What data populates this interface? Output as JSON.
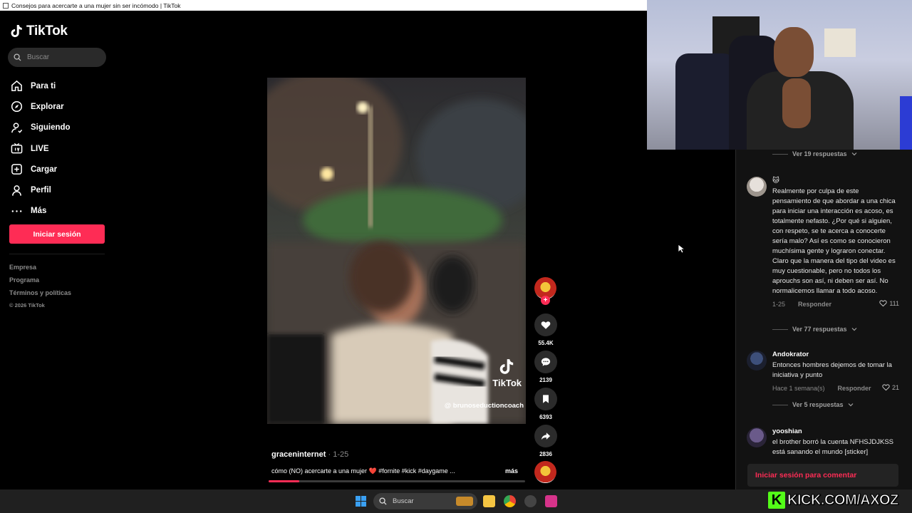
{
  "window": {
    "title": "Consejos para acercarte a una mujer sin ser incómodo | TikTok"
  },
  "sidebar": {
    "logo_text": "TikTok",
    "search_placeholder": "Buscar",
    "nav": [
      {
        "label": "Para ti",
        "icon": "home-icon"
      },
      {
        "label": "Explorar",
        "icon": "compass-icon"
      },
      {
        "label": "Siguiendo",
        "icon": "user-follow-icon"
      },
      {
        "label": "LIVE",
        "icon": "live-tv-icon"
      },
      {
        "label": "Cargar",
        "icon": "upload-plus-icon"
      },
      {
        "label": "Perfil",
        "icon": "profile-icon"
      },
      {
        "label": "Más",
        "icon": "more-dots-icon"
      }
    ],
    "login_label": "Iniciar sesión",
    "footer": [
      "Empresa",
      "Programa",
      "Términos y políticas"
    ],
    "copyright": "© 2026 TikTok"
  },
  "video": {
    "watermark": "TikTok",
    "watermark_handle": "@ brunoseductioncoach",
    "author": "graceninternet",
    "date": " · 1-25",
    "description": "cómo (NO) acercarte a una mujer ❤️ #fornite #kick #daygame ...",
    "more_label": "más",
    "progress": 0.12
  },
  "actions": {
    "follow_plus": "+",
    "likes": "55.4K",
    "comments": "2139",
    "saves": "6393",
    "shares": "2836"
  },
  "comments": {
    "replies_top": "Ver 19 respuestas",
    "items": [
      {
        "name": "🐱",
        "text": "Realmente por culpa de este pensamiento de que abordar a una chica para iniciar una interacción es acoso, es totalmente nefasto. ¿Por qué si alguien, con respeto, se te acerca a conocerte sería malo? Así es como se conocieron muchísima gente y lograron conectar. Claro que la manera del tipo del video es muy cuestionable, pero no todos los aprouchs son así, ni deben ser así. No normalicemos llamar a todo acoso.",
        "date": "1-25",
        "reply": "Responder",
        "likes": "111",
        "replies": "Ver 77 respuestas"
      },
      {
        "name": "Andokrator",
        "text": "Entonces hombres dejemos de tomar la iniciativa y punto",
        "date": "Hace 1 semana(s)",
        "reply": "Responder",
        "likes": "21",
        "replies": "Ver 5 respuestas"
      },
      {
        "name": "yooshian",
        "text": "el brother borró la cuenta NFHSJDJKSS está sanando el mundo [sticker]"
      }
    ],
    "login_label": "Iniciar sesión para comentar"
  },
  "taskbar": {
    "search_placeholder": "Buscar"
  },
  "overlay": {
    "kick_text": "KICK.COM/AXOZ",
    "kick_letter": "K"
  },
  "colors": {
    "accent": "#fe2c55",
    "kick": "#53fc18"
  }
}
